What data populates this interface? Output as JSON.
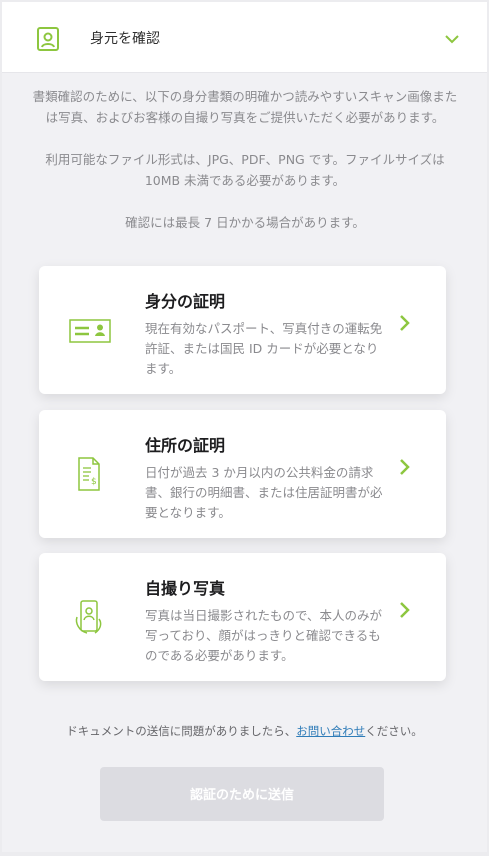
{
  "header": {
    "title": "身元を確認"
  },
  "intro": {
    "paragraph1": "書類確認のために、以下の身分書類の明確かつ読みやすいスキャン画像または写真、およびお客様の自撮り写真をご提供いただく必要があります。",
    "paragraph2": "利用可能なファイル形式は、JPG、PDF、PNG です。ファイルサイズは 10MB 未満である必要があります。",
    "paragraph3": "確認には最長 7 日かかる場合があります。"
  },
  "cards": [
    {
      "title": "身分の証明",
      "description": "現在有効なパスポート、写真付きの運転免許証、または国民 ID カードが必要となります。",
      "icon": "id-card-icon"
    },
    {
      "title": "住所の証明",
      "description": "日付が過去 3 か月以内の公共料金の請求書、銀行の明細書、または住居証明書が必要となります。",
      "icon": "bill-document-icon"
    },
    {
      "title": "自撮り写真",
      "description": "写真は当日撮影されたもので、本人のみが写っており、顔がはっきりと確認できるものである必要があります。",
      "icon": "selfie-phone-icon"
    }
  ],
  "footer": {
    "text_before": "ドキュメントの送信に問題がありましたら、",
    "link_text": "お問い合わせ",
    "text_after": "ください。"
  },
  "submit": {
    "label": "認証のために送信"
  },
  "colors": {
    "accent_green": "#8dc63f",
    "link_blue": "#2f7cb8",
    "disabled_button": "#dcdce1"
  }
}
